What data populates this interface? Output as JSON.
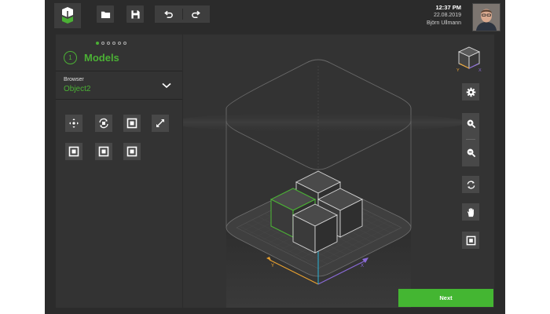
{
  "topbar": {
    "clock_time": "12:37 PM",
    "clock_date": "22.08.2019",
    "user_name": "Björn Ullmann",
    "icons": [
      "app-logo-icon",
      "folder-icon",
      "save-icon",
      "undo-icon",
      "redo-icon"
    ]
  },
  "panel": {
    "step_number": "1",
    "title": "Models",
    "step_count": 6,
    "active_step": 1,
    "browser_label": "Browser",
    "browser_value": "Object2",
    "tools": [
      "move-icon",
      "rotate-icon",
      "frame-icon",
      "scale-icon",
      "frame-icon",
      "frame-icon",
      "frame-icon"
    ]
  },
  "viewport": {
    "axis_x": "X",
    "axis_y": "Y",
    "axis_z": "Z",
    "cube_axis_x": "X",
    "cube_axis_y": "Y",
    "controls": [
      "settings-icon",
      "zoom-in-icon",
      "zoom-out-icon",
      "rotate-view-icon",
      "hand-pan-icon",
      "fit-frame-icon"
    ]
  },
  "colors": {
    "accent": "#4bb035",
    "axis_x": "#8a6ad8",
    "axis_y": "#e8a030",
    "axis_z": "#28b4d8"
  },
  "footer": {
    "next_label": "Next"
  }
}
